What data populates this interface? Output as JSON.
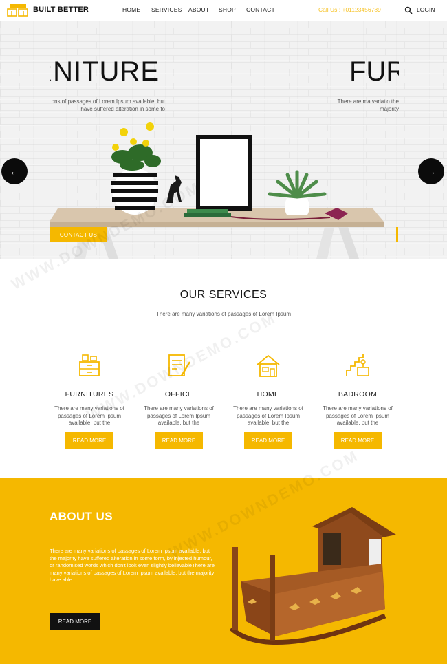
{
  "brand": {
    "name": "BUILT BETTER",
    "colors": {
      "accent": "#f5b800",
      "dark": "#111111"
    }
  },
  "nav": {
    "items": [
      "HOME",
      "SERVICES",
      "ABOUT",
      "SHOP",
      "CONTACT"
    ]
  },
  "header": {
    "call": "Call Us : +01123456789",
    "login": "LOGIN",
    "search_icon": "search-icon"
  },
  "hero": {
    "slide_title": "RNITURE",
    "slide_title_next": "FUR",
    "desc": "ons of passages of Lorem Ipsum available, but have suffered alteration in some fo",
    "desc_next": "There are ma variatio the majority",
    "cta": "CONTACT US",
    "prev": "←",
    "next": "→"
  },
  "services": {
    "title": "OUR SERVICES",
    "subtitle": "There are many variations of passages of Lorem Ipsum",
    "items": [
      {
        "name": "FURNITURES",
        "text": "There are many variations of passages of Lorem Ipsum available, but the",
        "button": "READ MORE",
        "icon": "furniture-icon"
      },
      {
        "name": "OFFICE",
        "text": "There are many variations of passages of Lorem Ipsum available, but the",
        "button": "READ MORE",
        "icon": "office-icon"
      },
      {
        "name": "HOME",
        "text": "There are many variations of passages of Lorem Ipsum available, but the",
        "button": "READ MORE",
        "icon": "home-icon"
      },
      {
        "name": "BADROOM",
        "text": "There are many variations of passages of Lorem Ipsum available, but the",
        "button": "READ MORE",
        "icon": "bedroom-icon"
      }
    ]
  },
  "about": {
    "title": "ABOUT US",
    "text": "There are many variations of passages of Lorem Ipsum available, but the majority have suffered alteration in some form, by injected humour, or randomised words which don't look even slightly believableThere are many variations of passages of Lorem Ipsum available, but the majority have able",
    "button": "READ MORE"
  },
  "watermark": "WWW.DOWNDEMO.COM"
}
